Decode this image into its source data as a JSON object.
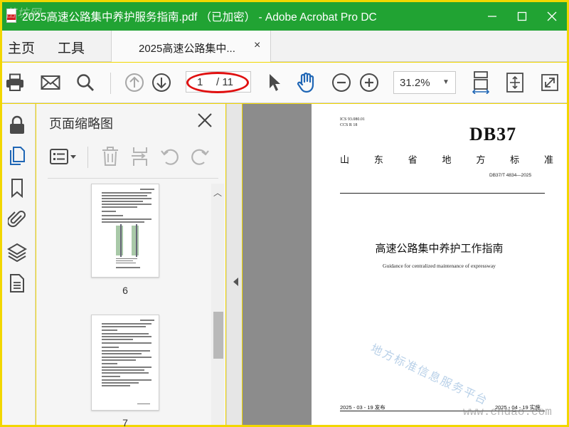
{
  "window": {
    "title": "2025高速公路集中养护服务指南.pdf （已加密） - Adobe Acrobat Pro DC",
    "watermark": "苗坊网",
    "controls": [
      "minimize-icon",
      "maximize-icon",
      "close-icon"
    ]
  },
  "menu": {
    "home": "主页",
    "tools": "工具",
    "tab_label": "2025高速公路集中...",
    "tab_close": "×"
  },
  "toolbar": {
    "icons": [
      "printer-icon",
      "mail-icon",
      "search-icon",
      "page-up-icon",
      "page-down-icon",
      "select-cursor-icon",
      "hand-tool-icon",
      "zoom-out-icon",
      "zoom-in-icon",
      "fit-width-icon",
      "fit-page-icon",
      "fullscreen-icon"
    ],
    "page_current": "1",
    "page_total": "/ 11",
    "zoom": "31.2%"
  },
  "rail": {
    "icons": [
      "lock-icon",
      "pages-icon",
      "bookmark-icon",
      "attachment-icon",
      "layers-icon",
      "document-icon"
    ]
  },
  "thumbnails_panel": {
    "title": "页面缩略图",
    "tools": [
      "options-icon",
      "delete-icon",
      "insert-icon",
      "rotate-left-icon",
      "rotate-right-icon"
    ],
    "pages": [
      "6",
      "7"
    ]
  },
  "document": {
    "ics": "ICS  93.080.01",
    "ccs": "CCS  R 18",
    "prefix": "DB37",
    "standard_chars": [
      "山",
      "东",
      "省",
      "地",
      "方",
      "标",
      "准"
    ],
    "number": "DB37/T  4834—2025",
    "title_cn": "高速公路集中养护工作指南",
    "title_en": "Guidance for centralized maintenance of expressway",
    "stamp": "地方标准信息服务平台",
    "publish": "2025 - 03 - 19 发布",
    "implement": "2025 - 04 - 19 实施"
  },
  "site_watermark": "www.cndao.com",
  "colors": {
    "titlebar": "#21a333",
    "frame": "#f2d700",
    "highlight_ring": "#e01010",
    "document_bg": "#8c8c8c"
  }
}
